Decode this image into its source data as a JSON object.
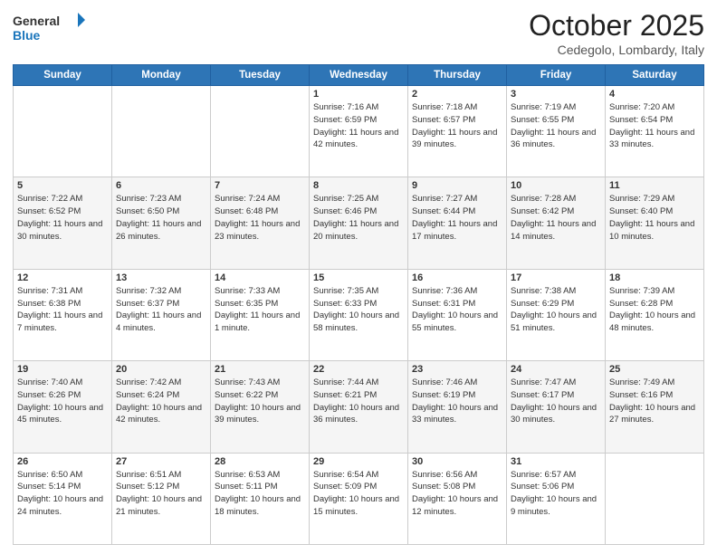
{
  "header": {
    "logo_line1": "General",
    "logo_line2": "Blue",
    "month": "October 2025",
    "location": "Cedegolo, Lombardy, Italy"
  },
  "days_of_week": [
    "Sunday",
    "Monday",
    "Tuesday",
    "Wednesday",
    "Thursday",
    "Friday",
    "Saturday"
  ],
  "weeks": [
    [
      {
        "day": "",
        "info": ""
      },
      {
        "day": "",
        "info": ""
      },
      {
        "day": "",
        "info": ""
      },
      {
        "day": "1",
        "info": "Sunrise: 7:16 AM\nSunset: 6:59 PM\nDaylight: 11 hours and 42 minutes."
      },
      {
        "day": "2",
        "info": "Sunrise: 7:18 AM\nSunset: 6:57 PM\nDaylight: 11 hours and 39 minutes."
      },
      {
        "day": "3",
        "info": "Sunrise: 7:19 AM\nSunset: 6:55 PM\nDaylight: 11 hours and 36 minutes."
      },
      {
        "day": "4",
        "info": "Sunrise: 7:20 AM\nSunset: 6:54 PM\nDaylight: 11 hours and 33 minutes."
      }
    ],
    [
      {
        "day": "5",
        "info": "Sunrise: 7:22 AM\nSunset: 6:52 PM\nDaylight: 11 hours and 30 minutes."
      },
      {
        "day": "6",
        "info": "Sunrise: 7:23 AM\nSunset: 6:50 PM\nDaylight: 11 hours and 26 minutes."
      },
      {
        "day": "7",
        "info": "Sunrise: 7:24 AM\nSunset: 6:48 PM\nDaylight: 11 hours and 23 minutes."
      },
      {
        "day": "8",
        "info": "Sunrise: 7:25 AM\nSunset: 6:46 PM\nDaylight: 11 hours and 20 minutes."
      },
      {
        "day": "9",
        "info": "Sunrise: 7:27 AM\nSunset: 6:44 PM\nDaylight: 11 hours and 17 minutes."
      },
      {
        "day": "10",
        "info": "Sunrise: 7:28 AM\nSunset: 6:42 PM\nDaylight: 11 hours and 14 minutes."
      },
      {
        "day": "11",
        "info": "Sunrise: 7:29 AM\nSunset: 6:40 PM\nDaylight: 11 hours and 10 minutes."
      }
    ],
    [
      {
        "day": "12",
        "info": "Sunrise: 7:31 AM\nSunset: 6:38 PM\nDaylight: 11 hours and 7 minutes."
      },
      {
        "day": "13",
        "info": "Sunrise: 7:32 AM\nSunset: 6:37 PM\nDaylight: 11 hours and 4 minutes."
      },
      {
        "day": "14",
        "info": "Sunrise: 7:33 AM\nSunset: 6:35 PM\nDaylight: 11 hours and 1 minute."
      },
      {
        "day": "15",
        "info": "Sunrise: 7:35 AM\nSunset: 6:33 PM\nDaylight: 10 hours and 58 minutes."
      },
      {
        "day": "16",
        "info": "Sunrise: 7:36 AM\nSunset: 6:31 PM\nDaylight: 10 hours and 55 minutes."
      },
      {
        "day": "17",
        "info": "Sunrise: 7:38 AM\nSunset: 6:29 PM\nDaylight: 10 hours and 51 minutes."
      },
      {
        "day": "18",
        "info": "Sunrise: 7:39 AM\nSunset: 6:28 PM\nDaylight: 10 hours and 48 minutes."
      }
    ],
    [
      {
        "day": "19",
        "info": "Sunrise: 7:40 AM\nSunset: 6:26 PM\nDaylight: 10 hours and 45 minutes."
      },
      {
        "day": "20",
        "info": "Sunrise: 7:42 AM\nSunset: 6:24 PM\nDaylight: 10 hours and 42 minutes."
      },
      {
        "day": "21",
        "info": "Sunrise: 7:43 AM\nSunset: 6:22 PM\nDaylight: 10 hours and 39 minutes."
      },
      {
        "day": "22",
        "info": "Sunrise: 7:44 AM\nSunset: 6:21 PM\nDaylight: 10 hours and 36 minutes."
      },
      {
        "day": "23",
        "info": "Sunrise: 7:46 AM\nSunset: 6:19 PM\nDaylight: 10 hours and 33 minutes."
      },
      {
        "day": "24",
        "info": "Sunrise: 7:47 AM\nSunset: 6:17 PM\nDaylight: 10 hours and 30 minutes."
      },
      {
        "day": "25",
        "info": "Sunrise: 7:49 AM\nSunset: 6:16 PM\nDaylight: 10 hours and 27 minutes."
      }
    ],
    [
      {
        "day": "26",
        "info": "Sunrise: 6:50 AM\nSunset: 5:14 PM\nDaylight: 10 hours and 24 minutes."
      },
      {
        "day": "27",
        "info": "Sunrise: 6:51 AM\nSunset: 5:12 PM\nDaylight: 10 hours and 21 minutes."
      },
      {
        "day": "28",
        "info": "Sunrise: 6:53 AM\nSunset: 5:11 PM\nDaylight: 10 hours and 18 minutes."
      },
      {
        "day": "29",
        "info": "Sunrise: 6:54 AM\nSunset: 5:09 PM\nDaylight: 10 hours and 15 minutes."
      },
      {
        "day": "30",
        "info": "Sunrise: 6:56 AM\nSunset: 5:08 PM\nDaylight: 10 hours and 12 minutes."
      },
      {
        "day": "31",
        "info": "Sunrise: 6:57 AM\nSunset: 5:06 PM\nDaylight: 10 hours and 9 minutes."
      },
      {
        "day": "",
        "info": ""
      }
    ]
  ]
}
